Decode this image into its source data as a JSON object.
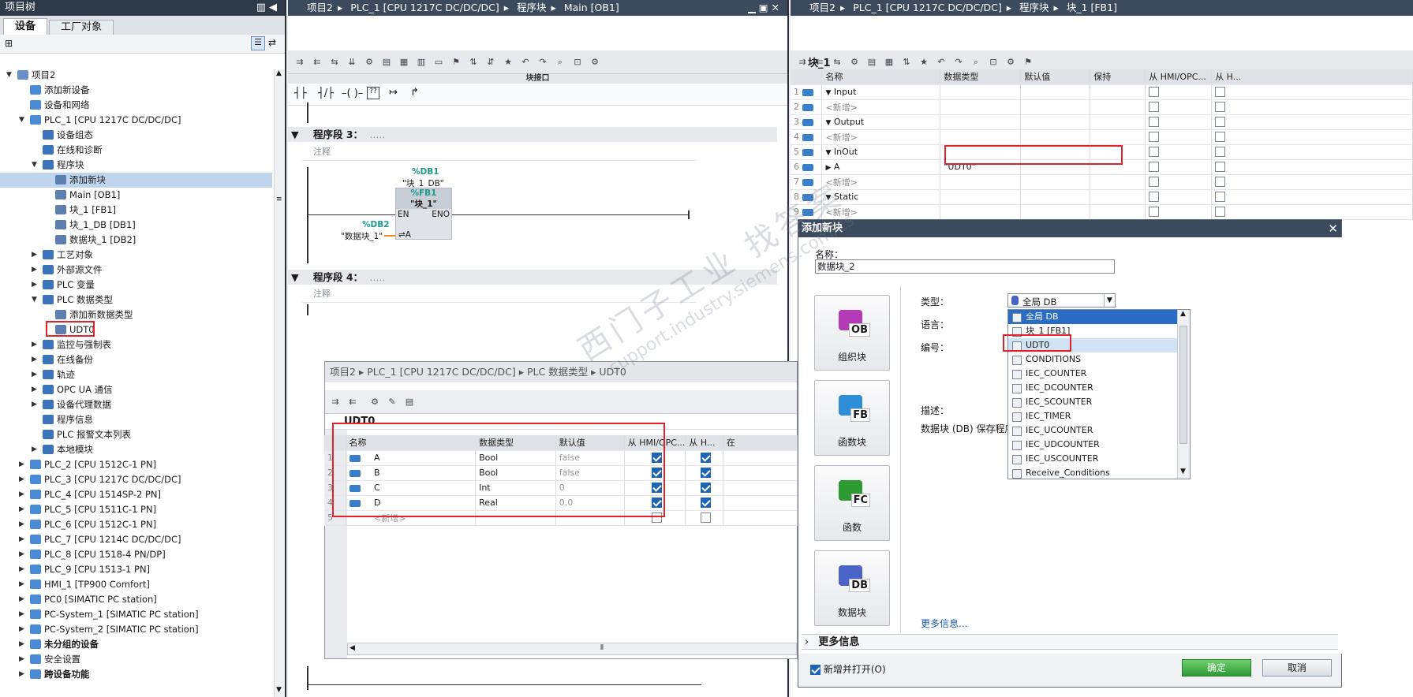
{
  "project_tree": {
    "title": "项目树",
    "tabs": [
      "设备",
      "工厂对象"
    ],
    "items": [
      {
        "label": "项目2",
        "level": 0,
        "tog": "▼"
      },
      {
        "label": "添加新设备",
        "level": 1,
        "tog": ""
      },
      {
        "label": "设备和网络",
        "level": 1,
        "tog": ""
      },
      {
        "label": "PLC_1 [CPU 1217C DC/DC/DC]",
        "level": 1,
        "tog": "▼"
      },
      {
        "label": "设备组态",
        "level": 2,
        "tog": ""
      },
      {
        "label": "在线和诊断",
        "level": 2,
        "tog": ""
      },
      {
        "label": "程序块",
        "level": 2,
        "tog": "▼"
      },
      {
        "label": "添加新块",
        "level": 3,
        "tog": ""
      },
      {
        "label": "Main [OB1]",
        "level": 3,
        "tog": ""
      },
      {
        "label": "块_1 [FB1]",
        "level": 3,
        "tog": ""
      },
      {
        "label": "块_1_DB [DB1]",
        "level": 3,
        "tog": ""
      },
      {
        "label": "数据块_1 [DB2]",
        "level": 3,
        "tog": ""
      },
      {
        "label": "工艺对象",
        "level": 2,
        "tog": "▶"
      },
      {
        "label": "外部源文件",
        "level": 2,
        "tog": "▶"
      },
      {
        "label": "PLC 变量",
        "level": 2,
        "tog": "▶"
      },
      {
        "label": "PLC 数据类型",
        "level": 2,
        "tog": "▼"
      },
      {
        "label": "添加新数据类型",
        "level": 3,
        "tog": ""
      },
      {
        "label": "UDT0",
        "level": 3,
        "tog": ""
      },
      {
        "label": "监控与强制表",
        "level": 2,
        "tog": "▶"
      },
      {
        "label": "在线备份",
        "level": 2,
        "tog": "▶"
      },
      {
        "label": "轨迹",
        "level": 2,
        "tog": "▶"
      },
      {
        "label": "OPC UA 通信",
        "level": 2,
        "tog": "▶"
      },
      {
        "label": "设备代理数据",
        "level": 2,
        "tog": "▶"
      },
      {
        "label": "程序信息",
        "level": 2,
        "tog": ""
      },
      {
        "label": "PLC 报警文本列表",
        "level": 2,
        "tog": ""
      },
      {
        "label": "本地模块",
        "level": 2,
        "tog": "▶"
      },
      {
        "label": "PLC_2 [CPU 1512C-1 PN]",
        "level": 1,
        "tog": "▶"
      },
      {
        "label": "PLC_3 [CPU 1217C DC/DC/DC]",
        "level": 1,
        "tog": "▶"
      },
      {
        "label": "PLC_4 [CPU 1514SP-2 PN]",
        "level": 1,
        "tog": "▶"
      },
      {
        "label": "PLC_5 [CPU 1511C-1 PN]",
        "level": 1,
        "tog": "▶"
      },
      {
        "label": "PLC_6 [CPU 1512C-1 PN]",
        "level": 1,
        "tog": "▶"
      },
      {
        "label": "PLC_7 [CPU 1214C DC/DC/DC]",
        "level": 1,
        "tog": "▶"
      },
      {
        "label": "PLC_8 [CPU 1518-4 PN/DP]",
        "level": 1,
        "tog": "▶"
      },
      {
        "label": "PLC_9 [CPU 1513-1 PN]",
        "level": 1,
        "tog": "▶"
      },
      {
        "label": "HMI_1 [TP900 Comfort]",
        "level": 1,
        "tog": "▶"
      },
      {
        "label": "PC0 [SIMATIC PC station]",
        "level": 1,
        "tog": "▶"
      },
      {
        "label": "PC-System_1 [SIMATIC PC station]",
        "level": 1,
        "tog": "▶"
      },
      {
        "label": "PC-System_2 [SIMATIC PC station]",
        "level": 1,
        "tog": "▶"
      },
      {
        "label": "未分组的设备",
        "level": 1,
        "tog": "▶"
      },
      {
        "label": "安全设置",
        "level": 1,
        "tog": "▶"
      },
      {
        "label": "跨设备功能",
        "level": 1,
        "tog": "▶"
      }
    ]
  },
  "ob_editor": {
    "crumbs": [
      "项目2",
      "PLC_1 [CPU 1217C DC/DC/DC]",
      "程序块",
      "Main [OB1]"
    ],
    "interface_label": "块接口",
    "net3": "程序段 3：",
    "net4": "程序段 4：",
    "comment": "注释",
    "dots": ".....",
    "db1_addr": "%DB1",
    "db1_name": "\"块_1_DB\"",
    "fb1_addr": "%FB1",
    "fb1_name": "\"块_1\"",
    "en": "EN",
    "eno": "ENO",
    "db2_addr": "%DB2",
    "db2_name": "\"数据块_1\"",
    "pin": "⇌A"
  },
  "fb_editor": {
    "crumbs": [
      "项目2",
      "PLC_1 [CPU 1217C DC/DC/DC]",
      "程序块",
      "块_1 [FB1]"
    ],
    "block_title": "块_1",
    "headers": [
      "名称",
      "数据类型",
      "默认值",
      "保持",
      "从 HMI/OPC...",
      "从 H..."
    ],
    "rows": [
      {
        "n": "1",
        "name": "Input",
        "tog": "▼",
        "type": ""
      },
      {
        "n": "2",
        "name": "<新增>",
        "tog": "",
        "type": ""
      },
      {
        "n": "3",
        "name": "Output",
        "tog": "▼",
        "type": ""
      },
      {
        "n": "4",
        "name": "<新增>",
        "tog": "",
        "type": ""
      },
      {
        "n": "5",
        "name": "InOut",
        "tog": "▼",
        "type": ""
      },
      {
        "n": "6",
        "name": "A",
        "tog": "▶",
        "type": "\"UDT0\""
      },
      {
        "n": "7",
        "name": "<新增>",
        "tog": "",
        "type": ""
      },
      {
        "n": "8",
        "name": "Static",
        "tog": "▼",
        "type": ""
      },
      {
        "n": "9",
        "name": "<新增>",
        "tog": "",
        "type": ""
      }
    ]
  },
  "udt_editor": {
    "crumbs": [
      "项目2",
      "PLC_1 [CPU 1217C DC/DC/DC]",
      "PLC 数据类型",
      "UDT0"
    ],
    "title": "UDT0",
    "headers": [
      "名称",
      "数据类型",
      "默认值",
      "从 HMI/OPC...",
      "从 H...",
      "在"
    ],
    "rows": [
      {
        "n": "1",
        "name": "A",
        "type": "Bool",
        "def": "false",
        "hmi": true,
        "h": true
      },
      {
        "n": "2",
        "name": "B",
        "type": "Bool",
        "def": "false",
        "hmi": true,
        "h": true
      },
      {
        "n": "3",
        "name": "C",
        "type": "Int",
        "def": "0",
        "hmi": true,
        "h": true
      },
      {
        "n": "4",
        "name": "D",
        "type": "Real",
        "def": "0.0",
        "hmi": true,
        "h": true
      },
      {
        "n": "5",
        "name": "<新增>",
        "type": "",
        "def": "",
        "hmi": false,
        "h": false
      }
    ]
  },
  "dialog": {
    "title": "添加新块",
    "name_label": "名称：",
    "name_value": "数据块_2",
    "tiles": [
      {
        "code": "OB",
        "label": "组织块",
        "color": "#b43bb8"
      },
      {
        "code": "FB",
        "label": "函数块",
        "color": "#2e8fd8"
      },
      {
        "code": "FC",
        "label": "函数",
        "color": "#2e9a32"
      },
      {
        "code": "DB",
        "label": "数据块",
        "color": "#4a63c9"
      }
    ],
    "type_label": "类型：",
    "type_value": "全局 DB",
    "lang_label": "语言：",
    "num_label": "编号：",
    "desc_label": "描述：",
    "desc_text": "数据块 (DB) 保存程序",
    "options": [
      "全局 DB",
      "块_1 [FB1]",
      "UDT0",
      "CONDITIONS",
      "IEC_COUNTER",
      "IEC_DCOUNTER",
      "IEC_SCOUNTER",
      "IEC_TIMER",
      "IEC_UCOUNTER",
      "IEC_UDCOUNTER",
      "IEC_USCOUNTER",
      "Receive_Conditions"
    ],
    "more_link": "更多信息...",
    "more_info": "更多信息",
    "add_open": "新增并打开(O)",
    "ok": "确定",
    "cancel": "取消"
  },
  "watermark": {
    "line1": "西门子工业 找答案",
    "line2": "support.industry.siemens.com/cs"
  },
  "colors": {
    "titlebar": "#3b4a5c",
    "selection": "#bfd5ee",
    "highlight": "#e0222a",
    "ok_button": "#35a73b"
  }
}
